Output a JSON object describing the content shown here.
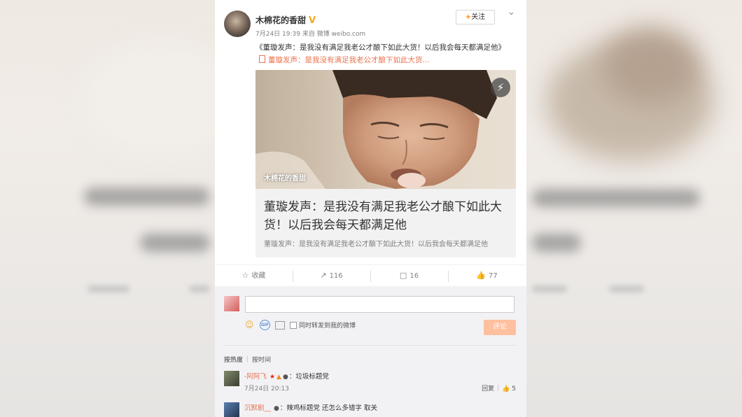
{
  "post": {
    "author": "木棉花的香甜",
    "verified_icon": "V",
    "meta": "7月24日 19:39 来自 微博 weibo.com",
    "follow_plus": "+",
    "follow_label": "关注",
    "text": "《董璇发声：是我没有满足我老公才酿下如此大货！以后我会每天都满足他》",
    "link_text": "董璇发声：是我没有满足我老公才酿下如此大货..."
  },
  "article": {
    "watermark": "木棉花的香甜",
    "title": "董璇发声：是我没有满足我老公才酿下如此大货！以后我会每天都满足他",
    "summary": "董璇发声：是我没有满足我老公才酿下如此大货！以后我会每天都满足他"
  },
  "actions": {
    "favorite_label": "收藏",
    "repost_count": "116",
    "comment_count": "16",
    "like_count": "77"
  },
  "composer": {
    "input_value": "",
    "sync_label": "同时转发到我的微博",
    "submit_label": "评论"
  },
  "sort": {
    "by_heat": "按热度",
    "by_time": "按时间"
  },
  "comments": [
    {
      "name": "-阿阿飞",
      "text": "：垃圾标题党",
      "time": "7月24日 20:13",
      "reply_label": "回复",
      "likes": "5"
    },
    {
      "name": "沉默剧__",
      "text": "：辣鸡标题党 还怎么多错字 取关",
      "time": "",
      "reply_label": "",
      "likes": ""
    }
  ],
  "colors": {
    "accent": "#eb7350",
    "follow_plus": "#ff8200",
    "submit_disabled": "#ffc09f"
  }
}
